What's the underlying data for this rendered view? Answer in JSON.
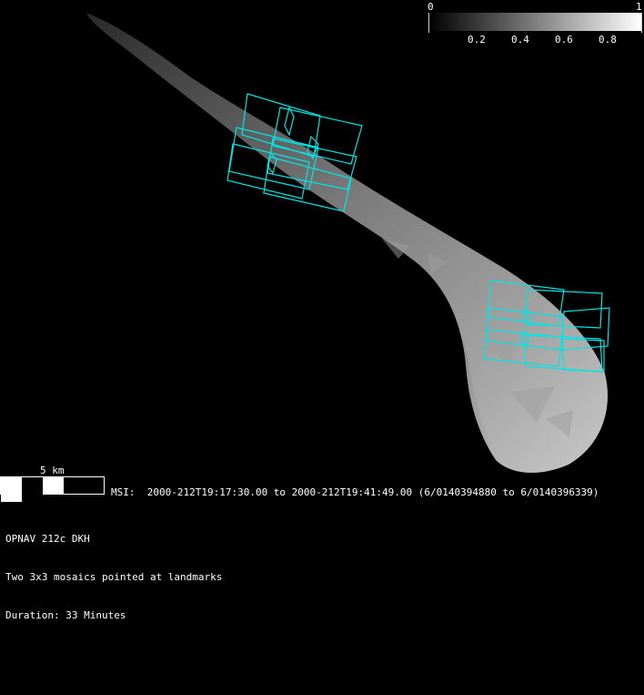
{
  "colorbar": {
    "min_label": "0",
    "max_label": "1",
    "ticks": [
      "0.2",
      "0.4",
      "0.6",
      "0.8"
    ]
  },
  "scale_bar": {
    "label": "5 km"
  },
  "msi_line": "MSI:  2000-212T19:17:30.00 to 2000-212T19:41:49.00 (6/0140394880 to 6/0140396339)",
  "info": {
    "line1": "OPNAV 212c DKH",
    "line2": "Two 3x3 mosaics pointed at landmarks",
    "line3": "Duration: 33 Minutes"
  },
  "colors": {
    "background": "#000000",
    "footprint": "#00e5e5",
    "asteroid": "#8a8a8a"
  }
}
